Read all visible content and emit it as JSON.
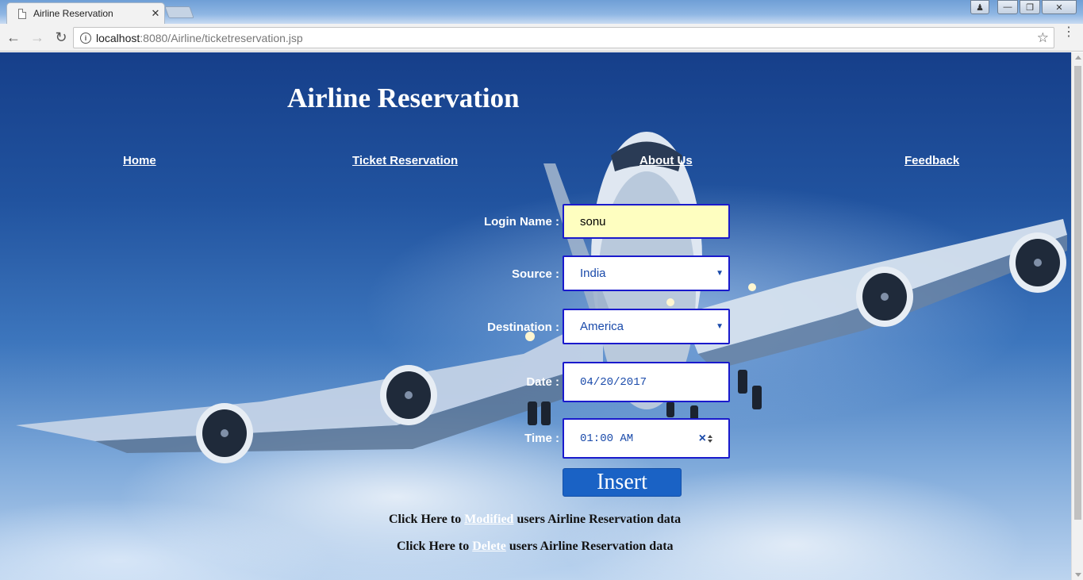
{
  "browser": {
    "tab_title": "Airline Reservation",
    "tab_close": "✕",
    "url_host": "localhost",
    "url_rest": ":8080/Airline/ticketreservation.jsp"
  },
  "page": {
    "title": "Airline Reservation",
    "nav": {
      "home": "Home",
      "ticket": "Ticket Reservation",
      "about": "About Us",
      "feedback": "Feedback"
    },
    "form": {
      "login_label": "Login Name :",
      "login_value": "sonu",
      "source_label": "Source :",
      "source_value": "India",
      "dest_label": "Destination :",
      "dest_value": "America",
      "date_label": "Date :",
      "date_value": "04/20/2017",
      "time_label": "Time :",
      "time_value": "01:00 AM",
      "submit_label": "Insert"
    },
    "modify_line": {
      "prefix": "Click Here to ",
      "link": "Modified",
      "suffix": " users Airline Reservation data"
    },
    "delete_line": {
      "prefix": "Click Here to ",
      "link": "Delete",
      "suffix": " users Airline Reservation data"
    }
  }
}
